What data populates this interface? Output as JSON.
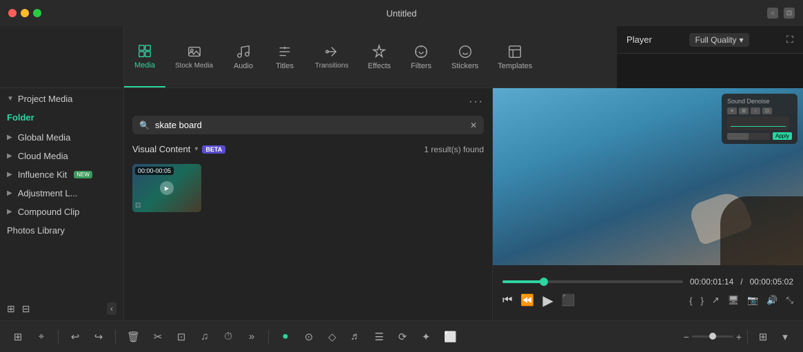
{
  "titlebar": {
    "title": "Untitled",
    "dots": [
      "red",
      "yellow",
      "green"
    ]
  },
  "toolbar": {
    "tabs": [
      {
        "id": "media",
        "label": "Media",
        "active": true,
        "icon": "media-icon"
      },
      {
        "id": "stock-media",
        "label": "Stock Media",
        "active": false,
        "icon": "stock-media-icon"
      },
      {
        "id": "audio",
        "label": "Audio",
        "active": false,
        "icon": "audio-icon"
      },
      {
        "id": "titles",
        "label": "Titles",
        "active": false,
        "icon": "titles-icon"
      },
      {
        "id": "transitions",
        "label": "Transitions",
        "active": false,
        "icon": "transitions-icon"
      },
      {
        "id": "effects",
        "label": "Effects",
        "active": false,
        "icon": "effects-icon"
      },
      {
        "id": "filters",
        "label": "Filters",
        "active": false,
        "icon": "filters-icon"
      },
      {
        "id": "stickers",
        "label": "Stickers",
        "active": false,
        "icon": "stickers-icon"
      },
      {
        "id": "templates",
        "label": "Templates",
        "active": false,
        "icon": "templates-icon"
      }
    ]
  },
  "sidebar": {
    "project_media_label": "Project Media",
    "folder_label": "Folder",
    "items": [
      {
        "label": "Global Media",
        "id": "global-media"
      },
      {
        "label": "Cloud Media",
        "id": "cloud-media"
      },
      {
        "label": "Influence Kit",
        "id": "influence-kit",
        "badge": "NEW"
      },
      {
        "label": "Adjustment L...",
        "id": "adjustment-layer"
      },
      {
        "label": "Compound Clip",
        "id": "compound-clip"
      },
      {
        "label": "Photos Library",
        "id": "photos-library"
      }
    ]
  },
  "content": {
    "search_placeholder": "skate board",
    "search_query": "skate board",
    "visual_content_label": "Visual Content",
    "beta_badge": "BETA",
    "results_count": "1 result(s) found",
    "thumbnail": {
      "duration": "00:00-00:05"
    }
  },
  "player": {
    "label": "Player",
    "quality": "Full Quality",
    "current_time": "00:00:01:14",
    "total_time": "00:00:05:02",
    "time_separator": "/",
    "progress_percent": 23
  },
  "bottom_toolbar": {
    "buttons": [
      {
        "id": "grid",
        "icon": "⊞",
        "label": "grid-view"
      },
      {
        "id": "select",
        "icon": "⌖",
        "label": "select-tool"
      },
      {
        "id": "undo",
        "icon": "↩",
        "label": "undo"
      },
      {
        "id": "redo",
        "icon": "↪",
        "label": "redo"
      },
      {
        "id": "delete",
        "icon": "🗑",
        "label": "delete"
      },
      {
        "id": "cut",
        "icon": "✂",
        "label": "cut"
      },
      {
        "id": "crop",
        "icon": "⊡",
        "label": "crop"
      },
      {
        "id": "audio-adj",
        "icon": "♫",
        "label": "audio-adjust"
      },
      {
        "id": "speed",
        "icon": "⏱",
        "label": "speed"
      },
      {
        "id": "more",
        "icon": "»",
        "label": "more"
      },
      {
        "id": "record",
        "icon": "⏺",
        "label": "record",
        "active": true
      },
      {
        "id": "ripple",
        "icon": "⊙",
        "label": "ripple"
      },
      {
        "id": "mark",
        "icon": "◇",
        "label": "mark"
      },
      {
        "id": "voice",
        "icon": "♬",
        "label": "voice"
      },
      {
        "id": "subtitle",
        "icon": "☰",
        "label": "subtitle"
      },
      {
        "id": "motion",
        "icon": "⟳",
        "label": "motion"
      },
      {
        "id": "ai",
        "icon": "✦",
        "label": "ai-tools"
      },
      {
        "id": "captions",
        "icon": "⬜",
        "label": "captions"
      },
      {
        "id": "zoom-out-btn",
        "icon": "−",
        "label": "zoom-out"
      },
      {
        "id": "zoom-in-btn",
        "icon": "+",
        "label": "zoom-in"
      },
      {
        "id": "layout",
        "icon": "⊞",
        "label": "layout-options"
      }
    ],
    "zoom_label": "zoom-slider"
  }
}
